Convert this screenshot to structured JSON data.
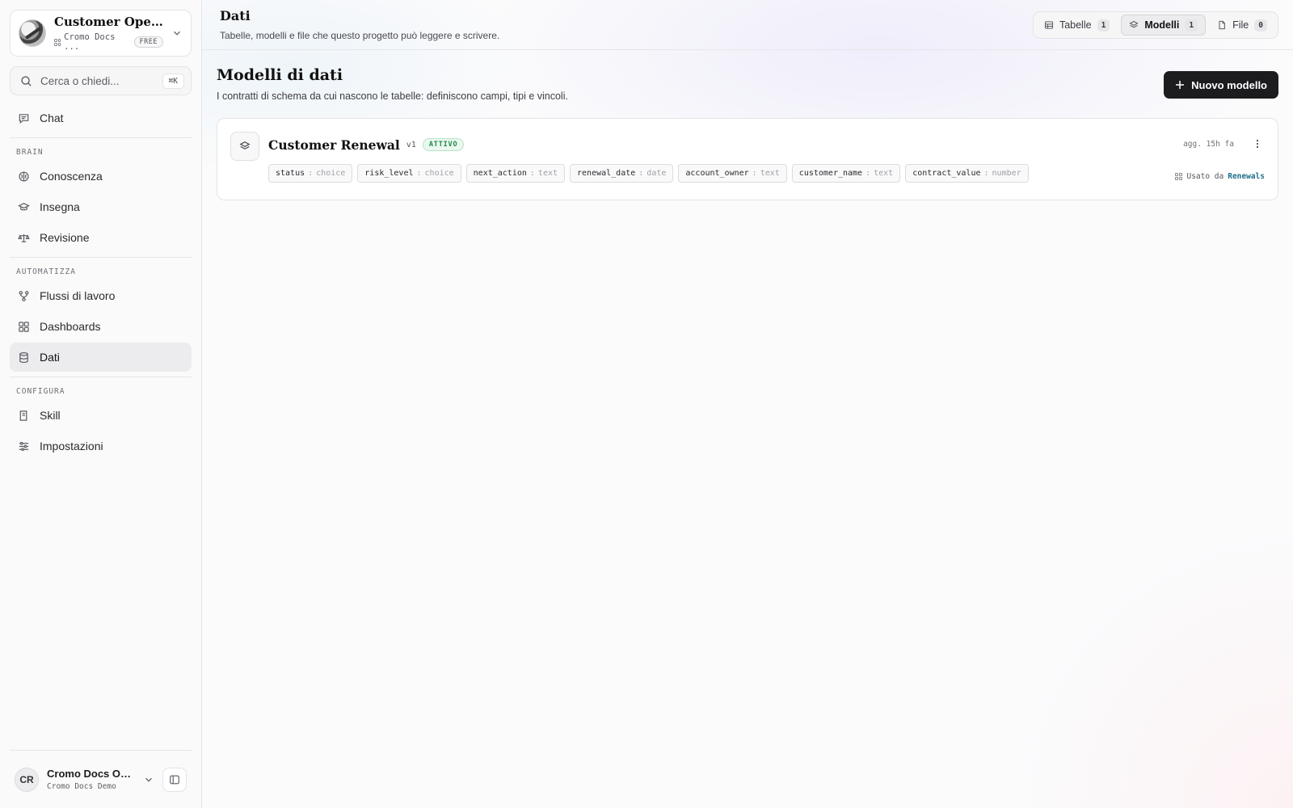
{
  "workspace": {
    "title": "Customer Operati...",
    "org": "Cromo Docs ...",
    "plan": "FREE"
  },
  "search": {
    "placeholder": "Cerca o chiedi...",
    "shortcut": "⌘K"
  },
  "nav": {
    "chat": "Chat",
    "brain_label": "BRAIN",
    "brain": [
      "Conoscenza",
      "Insegna",
      "Revisione"
    ],
    "automate_label": "AUTOMATIZZA",
    "automate": [
      "Flussi di lavoro",
      "Dashboards",
      "Dati"
    ],
    "configure_label": "CONFIGURA",
    "configure": [
      "Skill",
      "Impostazioni"
    ],
    "active": "Dati"
  },
  "user": {
    "initials": "CR",
    "name": "Cromo Docs Own...",
    "org": "Cromo Docs Demo"
  },
  "header": {
    "title": "Dati",
    "subtitle": "Tabelle, modelli e file che questo progetto può leggere e scrivere.",
    "tabs": [
      {
        "label": "Tabelle",
        "count": "1",
        "icon": "table-icon"
      },
      {
        "label": "Modelli",
        "count": "1",
        "icon": "layers-icon"
      },
      {
        "label": "File",
        "count": "0",
        "icon": "file-icon"
      }
    ],
    "active_tab": "Modelli"
  },
  "section": {
    "title": "Modelli di dati",
    "subtitle": "I contratti di schema da cui nascono le tabelle: definiscono campi, tipi e vincoli.",
    "new_button": "Nuovo modello"
  },
  "models": [
    {
      "name": "Customer Renewal",
      "version": "v1",
      "status": "ATTIVO",
      "updated": "agg. 15h fa",
      "used_by_label": "Usato da",
      "used_by": "Renewals",
      "fields": [
        {
          "name": "status",
          "type": "choice"
        },
        {
          "name": "risk_level",
          "type": "choice"
        },
        {
          "name": "next_action",
          "type": "text"
        },
        {
          "name": "renewal_date",
          "type": "date"
        },
        {
          "name": "account_owner",
          "type": "text"
        },
        {
          "name": "customer_name",
          "type": "text"
        },
        {
          "name": "contract_value",
          "type": "number"
        }
      ]
    }
  ],
  "colors": {
    "accent_dark": "#1c1c1f",
    "status_green": "#1e8a4a",
    "link_teal": "#1f6f8b"
  }
}
